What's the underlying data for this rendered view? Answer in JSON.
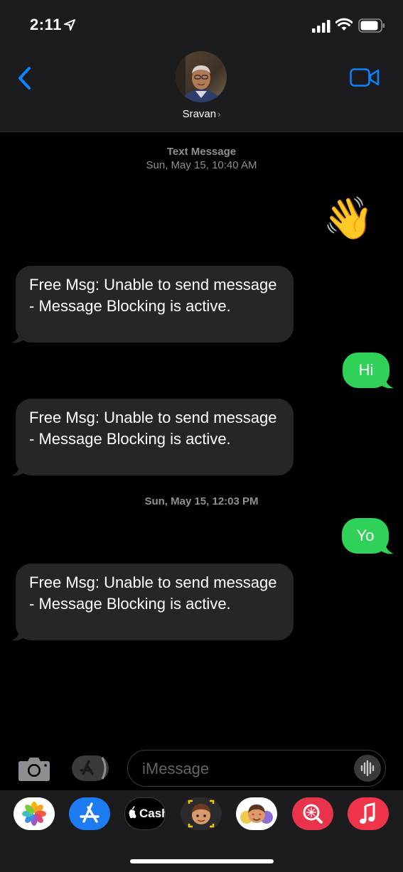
{
  "status_bar": {
    "time": "2:11"
  },
  "header": {
    "contact_name": "Sravan",
    "name_chevron": "›"
  },
  "thread": {
    "first_stamp": {
      "service": "Text Message",
      "datetime": "Sun, May 15, 10:40 AM"
    },
    "second_stamp": {
      "datetime": "Sun, May 15, 12:03 PM"
    },
    "wave_emoji": "👋",
    "incoming_1": " Free Msg: Unable to send message - Message Blocking is active.",
    "outgoing_hi": "Hi",
    "incoming_2": " Free Msg: Unable to send message - Message Blocking is active.",
    "outgoing_yo": "Yo",
    "incoming_3": " Free Msg: Unable to send message - Message Blocking is active."
  },
  "input_bar": {
    "placeholder": "iMessage"
  },
  "app_drawer": {
    "apps": [
      {
        "name": "photos-app-icon"
      },
      {
        "name": "app-store-app-icon"
      },
      {
        "name": "apple-cash-app-icon",
        "label": "Cash"
      },
      {
        "name": "memoji-app-icon"
      },
      {
        "name": "memoji-stickers-app-icon"
      },
      {
        "name": "search-images-app-icon"
      },
      {
        "name": "music-app-icon"
      }
    ]
  },
  "colors": {
    "accent_blue": "#0a84ff",
    "outgoing_bubble": "#30d158",
    "incoming_bubble": "#262628",
    "header_bg": "#1c1c1e"
  }
}
